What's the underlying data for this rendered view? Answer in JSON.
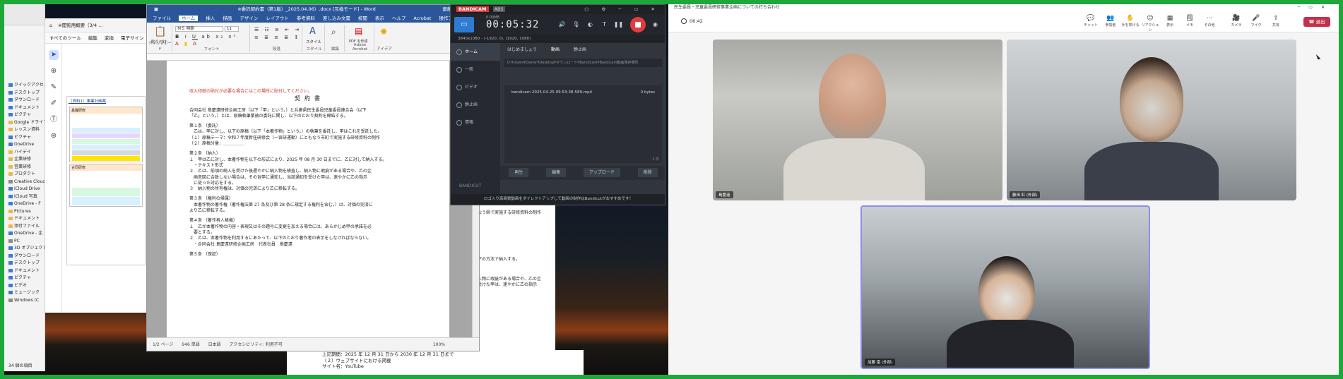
{
  "explorer": {
    "items": [
      "クイックアクセス",
      "デスクトップ",
      "ダウンロード",
      "ドキュメント",
      "ピクチャ",
      "Google ドライブ",
      "レッスン資料",
      "ピクチャ",
      "OneDrive",
      "ハイデイ",
      "企業研修",
      "営業研修",
      "プロダクト",
      "Creative Cloud",
      "iCloud Drive",
      "iCloud 写真",
      "OneDrive - F",
      "Pictures",
      "ドキュメント",
      "添付ファイル",
      "OneDrive - 企",
      "PC",
      "3D オブジェクト",
      "ダウンロード",
      "デスクトップ",
      "ドキュメント",
      "ピクチャ",
      "ビデオ",
      "ミュージック",
      "Windows (C"
    ],
    "footer": "34 個の項目"
  },
  "acrobat": {
    "title_tab": "※閲覧用概要（3/4 ...",
    "menu": [
      "すべてのツール",
      "編集",
      "変換",
      "電子サイン"
    ],
    "page_heading": "（資料1）事業計画案",
    "sections": [
      "基礎研修",
      "合同研修"
    ]
  },
  "word": {
    "title": "※委託契約書（第1版）_2025.04.06）.docx [互換モード] - Word",
    "user": "齋藤 進",
    "tabs": [
      "ファイル",
      "ホーム",
      "挿入",
      "描画",
      "デザイン",
      "レイアウト",
      "参考資料",
      "差し込み文書",
      "校閲",
      "表示",
      "ヘルプ",
      "Acrobat",
      "操作アシスト"
    ],
    "active_tab": "ホーム",
    "ribbon": {
      "clipboard": "クリップボード",
      "paste": "貼り付け",
      "font_name": "ＭＳ 明朝",
      "font_size": "11",
      "font": "フォント",
      "paragraph": "段落",
      "styles": "スタイル",
      "style_btn": "スタイル",
      "editing": "編集",
      "acrobat_group": "Adobe Acrobat",
      "create_pdf": "PDF を作成",
      "ideas": "アイデア"
    },
    "doc": {
      "notice": "収入印紙の貼付が必要な場合にはこの場所に貼付してください。",
      "heading": "契約書",
      "lines": [
        "合同会社 島慶遠研修企画工房（以下「甲」という。）と兵庫県民生委員児童委員連合会（以下",
        "「乙」という。）とは、原稿執筆業務の委託に関し、以下のとおり契約を締結する。",
        "",
        "第１条 （委託）",
        "　乙は、甲に対し、以下の原稿（以下「本著作物」という。）の執筆を委託し、甲はこれを受託した。",
        "（１）原稿テーマ：令和７年度新任研修会（一宮研運動）にともなう市町で実施する研修資料の制作",
        "（２）原稿分量：＿＿＿＿＿",
        "",
        "第２条 （納入）",
        "１　甲は乙に対し、本著作物を以下の形式により、2025 年 08 月 30 日までに、乙に対して納入する。",
        "　・テキスト形式",
        "２　乙は、前項の納入を受けた後遅やかに納入物を検査し、納入物に瑕疵がある場合や、乙の企",
        "　画意図に合致しない場合は、その旨甲に通知し、当該通知を受けた甲は、速やかに乙の指示",
        "　に従った対応をする。",
        "３　納入物の所有権は、対価の完済により乙に移転する。",
        "",
        "第３条 （権利の帰属）",
        "　本著作物の著作権（著作権法第 27 条及び第 28 条に規定する権利を含む。）は、対価の完済に",
        "より乙に移転する。",
        "",
        "第４条 （著作者人格権）",
        "１　乙が本著作物の内容・表現又はその題号に変更を加える場合には、あらかじめ甲の承諾を必",
        "　要とする。",
        "２　乙は、本著作物を利用するにあたって、以下のとおり著作者の表示をしなければならない。",
        "　・合同会社 島慶遠研修企画工房　代表社員　島慶遠",
        "",
        "第５条 （保証）"
      ]
    },
    "status": {
      "page": "1/2 ページ",
      "words": "946 単語",
      "lang": "日本語",
      "accessibility": "アクセシビリティ: 利用不可",
      "zoom": "100%"
    }
  },
  "bg_doc": {
    "fragments": [
      "なう県で実施する研修資料の制作",
      "下の方法で納入する。",
      "入物に瑕疵がある場合や、乙の企",
      "受けた甲は、速やかに乙の指示"
    ],
    "lines": [
      "上記期間：2025 年 12 月 31 日から 2030 年 12 月 31 日まで",
      "（２）ウェブサイトにおける掲載",
      "サイト名：YouTube"
    ]
  },
  "bandicam": {
    "logo": "BANDICAM",
    "badge": "ABS",
    "timer": "00:05:32",
    "size": "0.00MB",
    "resolution": "3840x1080 - (-1920, 0), (1920, 1080)",
    "side": [
      "ホーム",
      "一般",
      "ビデオ",
      "静止画",
      "情報"
    ],
    "active_side": "ホーム",
    "tabs": [
      "はじめましょう",
      "動画",
      "静止画"
    ],
    "path": "D:¥Users¥Owner¥Desktop¥ダウンロード¥Bandicam¥Bandicam動画保存場所",
    "file_name": "bandicam 2025-04-25 09-53-38-589.mp4",
    "file_size": "0 bytes",
    "count": "1 件",
    "buttons": [
      "再生",
      "編集",
      "アップロード",
      "削除"
    ],
    "brand": "BANDICUT",
    "footer": "ロゴ入り高画質動画をダイレクトアップして動画の制作はBandicutがおすすめです！"
  },
  "meeting": {
    "title": "民生委員・児童委員研修事業企画についての打ち合わせ",
    "elapsed": "06:42",
    "toolbar": [
      "チャット",
      "参加者",
      "手を挙げる",
      "リアクション",
      "表示",
      "メモ",
      "その他",
      "カメラ",
      "マイク",
      "共有"
    ],
    "leave": "退出",
    "participants": [
      {
        "name": "島慶遠"
      },
      {
        "name": "藤田 紅 (外部)"
      },
      {
        "name": "加藤 南 (外部)"
      }
    ]
  }
}
